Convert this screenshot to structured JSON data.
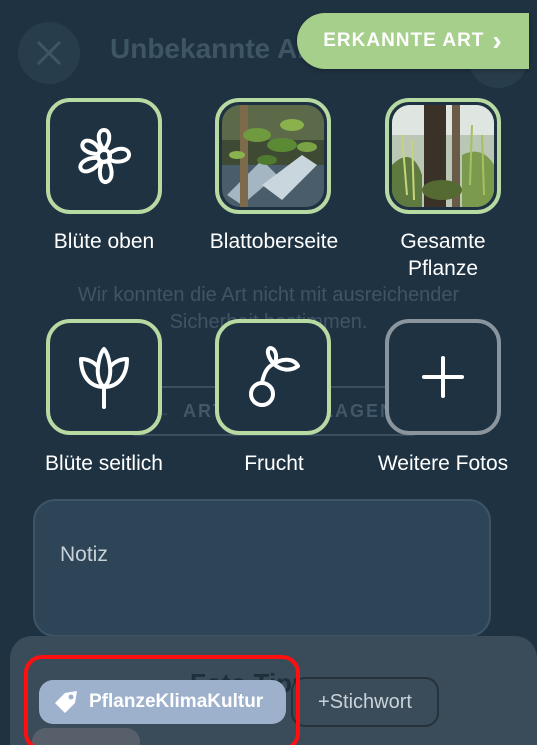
{
  "header": {
    "title": "Unbekannte Art",
    "recognized_button": "ERKANNTE ART",
    "recognized_chevron": "›"
  },
  "background": {
    "message": "Wir konnten die Art nicht mit ausreichender Sicherheit bestimmen.",
    "suggest_button": "ART VORSCHLAGEN"
  },
  "tiles": [
    {
      "label": "Blüte oben",
      "icon": "flower-icon"
    },
    {
      "label": "Blattoberseite",
      "icon": "leaf-photo"
    },
    {
      "label": "Gesamte Pflanze",
      "icon": "plant-photo"
    },
    {
      "label": "Blüte seitlich",
      "icon": "tulip-icon"
    },
    {
      "label": "Frucht",
      "icon": "fruit-icon"
    },
    {
      "label": "Weitere Fotos",
      "icon": "plus-icon"
    }
  ],
  "note": {
    "placeholder": "Notiz"
  },
  "sheet": {
    "title": "Foto Tipps",
    "tag_label": "PflanzeKlimaKultur",
    "add_tag_label": "+Stichwort"
  },
  "colors": {
    "background": "#1f3241",
    "accent_green": "#a6cf8c",
    "tile_border_green": "#b7d9a2",
    "tag_chip": "#9db1cd",
    "highlight_red": "#ff1010"
  }
}
